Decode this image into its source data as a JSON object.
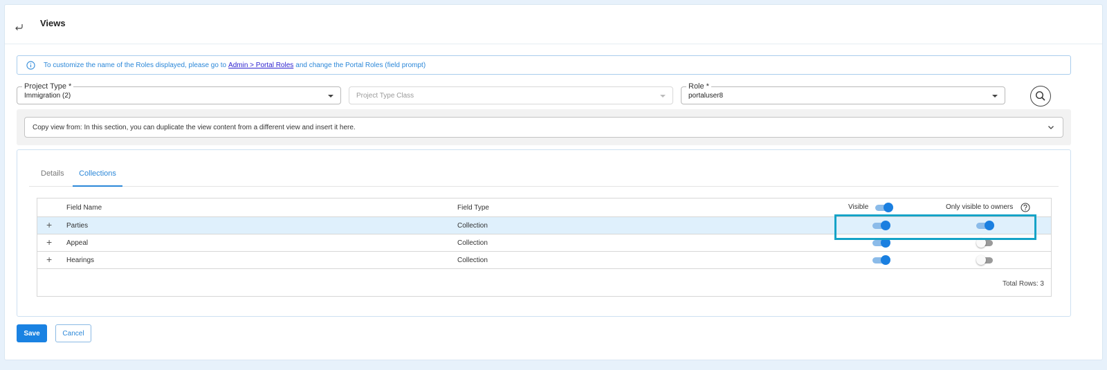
{
  "header": {
    "title": "Views",
    "back_icon": "return-arrow-icon"
  },
  "info": {
    "text_before": "To customize the name of the Roles displayed, please go to",
    "link": "Admin > Portal Roles",
    "text_after": "and change the Portal Roles (field prompt)",
    "icon": "info-icon"
  },
  "filters": {
    "project_type": {
      "label": "Project Type *",
      "value": "Immigration (2)"
    },
    "project_type_class": {
      "placeholder": "Project Type Class"
    },
    "role": {
      "label": "Role *",
      "value": "portaluser8"
    },
    "search_icon": "search-icon"
  },
  "copy_view": {
    "text": "Copy view from: In this section, you can duplicate the view content from a different view and insert it here."
  },
  "tabs": [
    {
      "label": "Details",
      "active": false
    },
    {
      "label": "Collections",
      "active": true
    }
  ],
  "grid": {
    "columns": {
      "field_name": "Field Name",
      "field_type": "Field Type",
      "visible": "Visible",
      "only_owners": "Only visible to owners"
    },
    "header_visible_toggle": true,
    "rows": [
      {
        "expand": "+",
        "field_name": "Parties",
        "field_type": "Collection",
        "visible": true,
        "only_owners": true,
        "selected": true
      },
      {
        "expand": "+",
        "field_name": "Appeal",
        "field_type": "Collection",
        "visible": true,
        "only_owners": false,
        "selected": false
      },
      {
        "expand": "+",
        "field_name": "Hearings",
        "field_type": "Collection",
        "visible": true,
        "only_owners": false,
        "selected": false
      }
    ],
    "total_rows": "Total Rows: 3"
  },
  "actions": {
    "save": "Save",
    "cancel": "Cancel"
  },
  "colors": {
    "accent": "#1a82e2",
    "highlight": "#15a3c7",
    "selected_row": "#dff0fc"
  }
}
